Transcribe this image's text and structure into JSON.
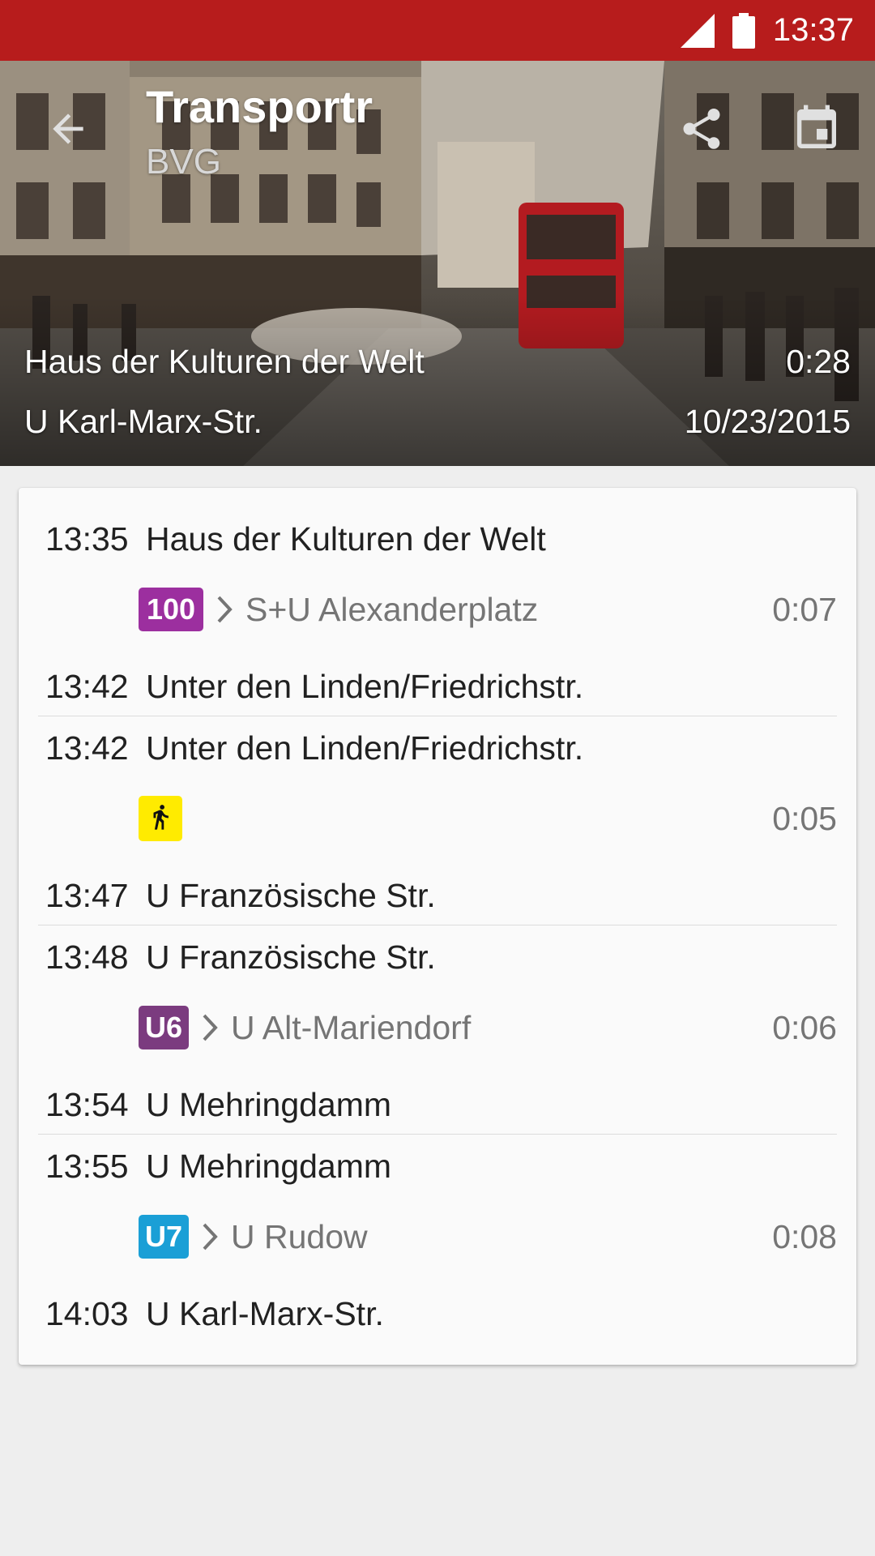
{
  "status_bar": {
    "time": "13:37"
  },
  "header": {
    "title": "Transportr",
    "subtitle": "BVG",
    "from": "Haus der Kulturen der Welt",
    "duration": "0:28",
    "to": "U Karl-Marx-Str.",
    "date": "10/23/2015"
  },
  "legs": [
    {
      "dep_time": "13:35",
      "dep_stop": "Haus der Kulturen der Welt",
      "line": "100",
      "line_color": "#9c2f9f",
      "direction": "S+U Alexanderplatz",
      "duration": "0:07",
      "arr_time": "13:42",
      "arr_stop": "Unter den Linden/Friedrichstr."
    },
    {
      "dep_time": "13:42",
      "dep_stop": "Unter den Linden/Friedrichstr.",
      "line": "walk",
      "line_color": "#ffeb00",
      "direction": "",
      "duration": "0:05",
      "arr_time": "13:47",
      "arr_stop": "U Französische Str."
    },
    {
      "dep_time": "13:48",
      "dep_stop": "U Französische Str.",
      "line": "U6",
      "line_color": "#7b3b7f",
      "direction": "U Alt-Mariendorf",
      "duration": "0:06",
      "arr_time": "13:54",
      "arr_stop": "U Mehringdamm"
    },
    {
      "dep_time": "13:55",
      "dep_stop": "U Mehringdamm",
      "line": "U7",
      "line_color": "#1a9fd6",
      "direction": "U Rudow",
      "duration": "0:08",
      "arr_time": "14:03",
      "arr_stop": "U Karl-Marx-Str."
    }
  ]
}
